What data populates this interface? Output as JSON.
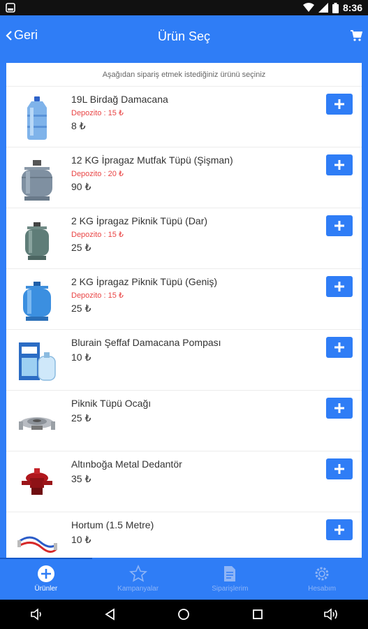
{
  "status_bar": {
    "time": "8:36"
  },
  "app_bar": {
    "back_label": "Geri",
    "title": "Ürün Seç",
    "cart_icon": "cart-icon"
  },
  "hint": "Aşağıdan sipariş etmek istediğiniz ürünü seçiniz",
  "products": [
    {
      "name": "19L Birdağ Damacana",
      "deposit": "Depozito : 15 ₺",
      "price": "8 ₺",
      "image": "water-bottle"
    },
    {
      "name": "12 KG İpragaz Mutfak Tüpü (Şişman)",
      "deposit": "Depozito : 20 ₺",
      "price": "90 ₺",
      "image": "gas-cylinder-large"
    },
    {
      "name": "2 KG İpragaz Piknik Tüpü (Dar)",
      "deposit": "Depozito : 15 ₺",
      "price": "25 ₺",
      "image": "gas-cylinder-small"
    },
    {
      "name": "2 KG İpragaz Piknik Tüpü (Geniş)",
      "deposit": "Depozito : 15 ₺",
      "price": "25 ₺",
      "image": "gas-cylinder-blue"
    },
    {
      "name": "Blurain Şeffaf Damacana Pompası",
      "price": "10 ₺",
      "image": "water-pump-box"
    },
    {
      "name": "Piknik Tüpü Ocağı",
      "price": "25 ₺",
      "image": "camping-stove"
    },
    {
      "name": "Altınboğa Metal Dedantör",
      "price": "35 ₺",
      "image": "gas-regulator"
    },
    {
      "name": "Hortum (1.5 Metre)",
      "price": "10 ₺",
      "image": "gas-hose"
    }
  ],
  "bottom_nav": [
    {
      "label": "Ürünler",
      "icon": "plus-circle-icon",
      "active": true
    },
    {
      "label": "Kampanyalar",
      "icon": "star-icon",
      "active": false
    },
    {
      "label": "Siparişlerim",
      "icon": "document-icon",
      "active": false
    },
    {
      "label": "Hesabım",
      "icon": "gear-icon",
      "active": false
    }
  ],
  "colors": {
    "primary": "#2f7df6",
    "deposit": "#e94545"
  }
}
